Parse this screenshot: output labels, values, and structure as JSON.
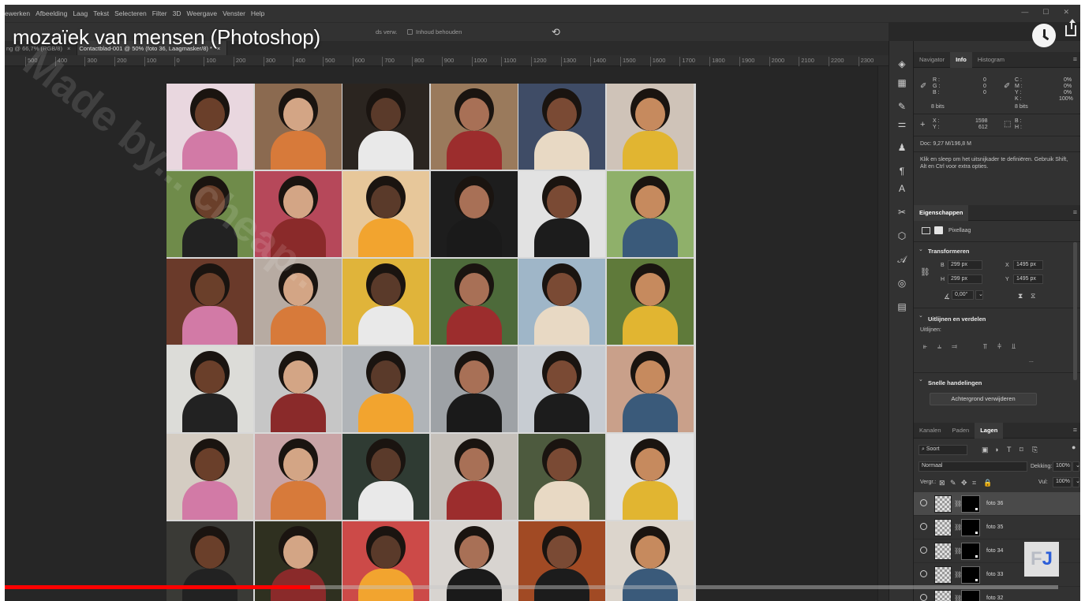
{
  "video": {
    "title": "mozaïek van mensen (Photoshop)",
    "progress": 0.29
  },
  "menubar": {
    "items": [
      "ewerken",
      "Afbeelding",
      "Laag",
      "Tekst",
      "Selecteren",
      "Filter",
      "3D",
      "Weergave",
      "Venster",
      "Help"
    ]
  },
  "optionsbar": {
    "partial_label": "ds verw.",
    "checkbox_label": "Inhoud behouden"
  },
  "tabs": [
    {
      "label": "ng @ 66,7% (RGB/8)",
      "close": "×"
    },
    {
      "label": "Contactblad-001 @ 50% (foto 36, Laagmasker/8) *",
      "close": "×"
    }
  ],
  "ruler": {
    "ticks": [
      "500",
      "400",
      "300",
      "200",
      "100",
      "0",
      "100",
      "200",
      "300",
      "400",
      "500",
      "600",
      "700",
      "800",
      "900",
      "1000",
      "1100",
      "1200",
      "1300",
      "1400",
      "1500",
      "1600",
      "1700",
      "1800",
      "1900",
      "2000",
      "2100",
      "2200",
      "2300"
    ]
  },
  "watermark": {
    "text": "Made by... cheap.."
  },
  "info_panel": {
    "tabs": [
      "Navigator",
      "Info",
      "Histogram"
    ],
    "rgb": {
      "r_label": "R :",
      "g_label": "G :",
      "b_label": "B :",
      "r": "0",
      "g": "0",
      "b": "0",
      "bits": "8 bits"
    },
    "cmyk": {
      "c_label": "C :",
      "m_label": "M :",
      "y_label": "Y :",
      "k_label": "K :",
      "c": "0%",
      "m": "0%",
      "y": "0%",
      "k": "100%",
      "bits": "8 bits"
    },
    "xy": {
      "x_label": "X :",
      "y_label": "Y :",
      "x": "1598",
      "y": "612"
    },
    "wh": {
      "w_label": "B :",
      "h_label": "H :"
    },
    "doc": "Doc: 9,27 M/196,8 M",
    "hint": "Klik en sleep om het uitsnijkader te definiëren. Gebruik Shift, Alt en Ctrl voor extra opties."
  },
  "properties_panel": {
    "tab": "Eigenschappen",
    "layer_type": "Pixellaag",
    "transform_title": "Transformeren",
    "b_label": "B",
    "h_label": "H",
    "x_label": "X",
    "y_label": "Y",
    "b_value": "299 px",
    "h_value": "299 px",
    "x_value": "1495 px",
    "y_value": "1495 px",
    "angle": "0,00°",
    "align_title": "Uitlijnen en verdelen",
    "align_label": "Uitlijnen:",
    "more": "...",
    "quick_title": "Snelle handelingen",
    "remove_bg_button": "Achtergrond verwijderen"
  },
  "layers_panel": {
    "tabs": [
      "Kanalen",
      "Paden",
      "Lagen"
    ],
    "filter_label": "Soort",
    "blend_mode": "Normaal",
    "opacity_label": "Dekking:",
    "opacity": "100%",
    "lock_label": "Vergr.:",
    "fill_label": "Vul:",
    "fill": "100%",
    "layers": [
      {
        "name": "foto 36"
      },
      {
        "name": "foto 35"
      },
      {
        "name": "foto 34"
      },
      {
        "name": "foto 33"
      },
      {
        "name": "foto 32"
      }
    ]
  },
  "logo": {
    "f": "F",
    "j": "J"
  },
  "colors": {
    "accent_red": "#ff0000",
    "panel_bg": "#323232",
    "canvas_bg": "#262626"
  }
}
